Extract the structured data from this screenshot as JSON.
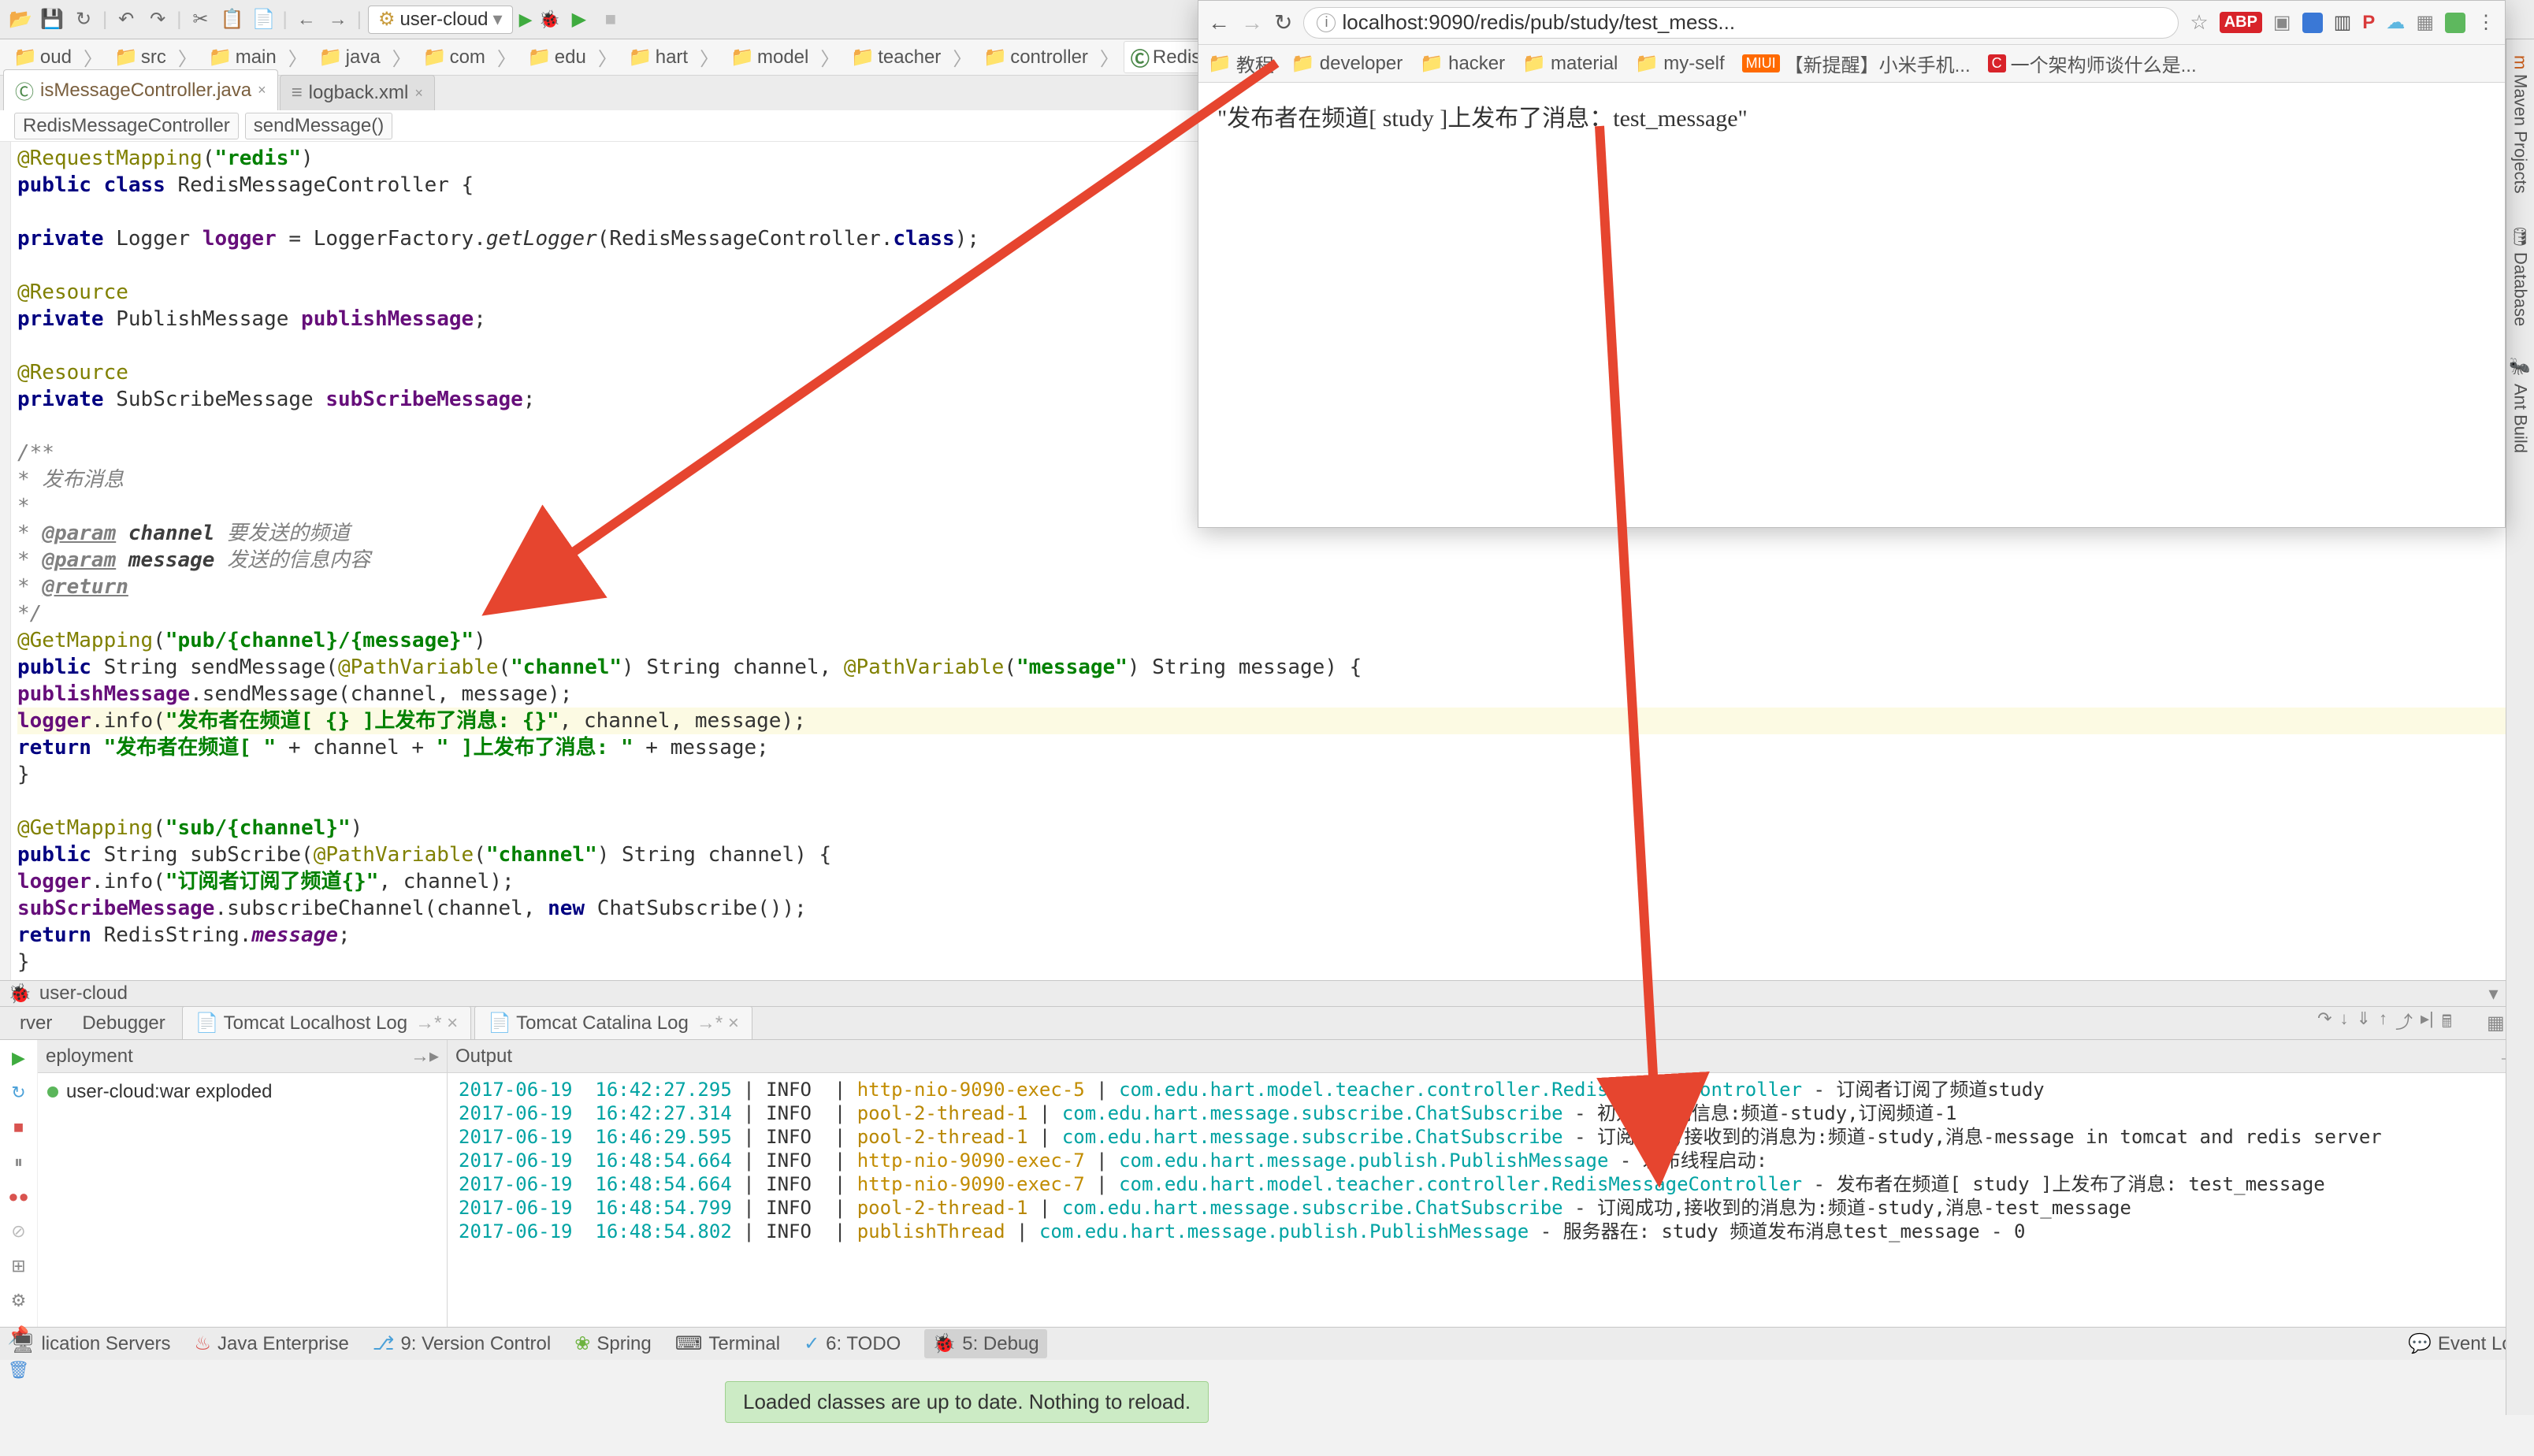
{
  "toolbar": {
    "run_config": "user-cloud"
  },
  "breadcrumbs": [
    "oud",
    "src",
    "main",
    "java",
    "com",
    "edu",
    "hart",
    "model",
    "teacher",
    "controller",
    "RedisMessageController"
  ],
  "tabs": [
    {
      "name": "isMessageController.java",
      "active": true
    },
    {
      "name": "logback.xml",
      "active": false
    }
  ],
  "crumb_inner": [
    "RedisMessageController",
    "sendMessage()"
  ],
  "code": {
    "l1a": "@RequestMapping",
    "l1b": "(",
    "l1c": "\"redis\"",
    "l1d": ")",
    "l2a": "public class ",
    "l2b": "RedisMessageController {",
    "l3a": "    private ",
    "l3b": "Logger ",
    "l3c": "logger",
    "l3d": " = LoggerFactory.",
    "l3e": "getLogger",
    "l3f": "(RedisMessageController.",
    "l3g": "class",
    "l3h": ");",
    "l4": "    @Resource",
    "l5a": "    private ",
    "l5b": "PublishMessage ",
    "l5c": "publishMessage",
    "l5d": ";",
    "l6": "    @Resource",
    "l7a": "    private ",
    "l7b": "SubScribeMessage ",
    "l7c": "subScribeMessage",
    "l7d": ";",
    "l8": "    /**",
    "l9": "     * 发布消息",
    "l10": "     *",
    "l11a": "     * ",
    "l11b": "@param",
    "l11c": " channel",
    "l11d": " 要发送的频道",
    "l12a": "     * ",
    "l12b": "@param",
    "l12c": " message",
    "l12d": " 发送的信息内容",
    "l13a": "     * ",
    "l13b": "@return",
    "l14": "     */",
    "l15a": "    @GetMapping",
    "l15b": "(",
    "l15c": "\"pub/{channel}/{message}\"",
    "l15d": ")",
    "l16a": "    public ",
    "l16b": "String sendMessage(",
    "l16c": "@PathVariable",
    "l16d": "(",
    "l16e": "\"channel\"",
    "l16f": ") String channel, ",
    "l16g": "@PathVariable",
    "l16h": "(",
    "l16i": "\"message\"",
    "l16j": ") String message) {",
    "l17a": "        publishMessage",
    "l17b": ".sendMessage(channel, message);",
    "l18a": "        logger",
    "l18b": ".info(",
    "l18c": "\"发布者在频道[ {} ]上发布了消息: {}\"",
    "l18d": ", channel, message);",
    "l19a": "        return ",
    "l19b": "\"发布者在频道[ \"",
    "l19c": " + channel + ",
    "l19d": "\" ]上发布了消息: \"",
    "l19e": " + message;",
    "l20": "    }",
    "l21a": "    @GetMapping",
    "l21b": "(",
    "l21c": "\"sub/{channel}\"",
    "l21d": ")",
    "l22a": "    public ",
    "l22b": "String subScribe(",
    "l22c": "@PathVariable",
    "l22d": "(",
    "l22e": "\"channel\"",
    "l22f": ") String channel) {",
    "l23a": "        logger",
    "l23b": ".info(",
    "l23c": "\"订阅者订阅了频道{}\"",
    "l23d": ", channel);",
    "l24a": "        subScribeMessage",
    "l24b": ".subscribeChannel(channel, ",
    "l24c": "new ",
    "l24d": "ChatSubscribe());",
    "l25a": "        return ",
    "l25b": "RedisString.",
    "l25c": "message",
    "l25d": ";",
    "l26": "    }"
  },
  "right_tabs": [
    "Maven Projects",
    "Database",
    "Ant Build"
  ],
  "debug": {
    "title": "user-cloud",
    "tabs": [
      "rver",
      "Debugger",
      "Tomcat Localhost Log",
      "Tomcat Catalina Log"
    ],
    "dep_hdr": "eployment",
    "out_hdr": "Output",
    "deployment": "user-cloud:war exploded"
  },
  "console_lines": [
    {
      "d": "2017-06-19",
      "t": "16:42:27.295",
      "lvl": "INFO",
      "th": "http-nio-9090-exec-5",
      "thc": "th-http",
      "cls": "com.edu.hart.model.teacher.controller.RedisMessageController",
      "msg": "- 订阅者订阅了频道study"
    },
    {
      "d": "2017-06-19",
      "t": "16:42:27.314",
      "lvl": "INFO",
      "th": "pool-2-thread-1",
      "thc": "th-pool",
      "cls": "com.edu.hart.message.subscribe.ChatSubscribe",
      "msg": "- 初始化订阅信息:频道-study,订阅频道-1"
    },
    {
      "d": "2017-06-19",
      "t": "16:46:29.595",
      "lvl": "INFO",
      "th": "pool-2-thread-1",
      "thc": "th-pool",
      "cls": "com.edu.hart.message.subscribe.ChatSubscribe",
      "msg": "- 订阅成功,接收到的消息为:频道-study,消息-message in tomcat and redis server"
    },
    {
      "d": "2017-06-19",
      "t": "16:48:54.664",
      "lvl": "INFO",
      "th": "http-nio-9090-exec-7",
      "thc": "th-http",
      "cls": "com.edu.hart.message.publish.PublishMessage",
      "msg": "- 发布线程启动:"
    },
    {
      "d": "2017-06-19",
      "t": "16:48:54.664",
      "lvl": "INFO",
      "th": "http-nio-9090-exec-7",
      "thc": "th-http",
      "cls": "com.edu.hart.model.teacher.controller.RedisMessageController",
      "msg": "- 发布者在频道[ study ]上发布了消息: test_message"
    },
    {
      "d": "2017-06-19",
      "t": "16:48:54.799",
      "lvl": "INFO",
      "th": "pool-2-thread-1",
      "thc": "th-pool",
      "cls": "com.edu.hart.message.subscribe.ChatSubscribe",
      "msg": "- 订阅成功,接收到的消息为:频道-study,消息-test_message"
    },
    {
      "d": "2017-06-19",
      "t": "16:48:54.802",
      "lvl": "INFO",
      "th": "publishThread",
      "thc": "th-pub",
      "cls": "com.edu.hart.message.publish.PublishMessage",
      "msg": "- 服务器在: study 频道发布消息test_message - 0"
    }
  ],
  "bottom": {
    "items": [
      "lication Servers",
      "Java Enterprise",
      "9: Version Control",
      "Spring",
      "Terminal",
      "6: TODO",
      "5: Debug"
    ],
    "event_log": "Event Log"
  },
  "reload": "Loaded classes are up to date. Nothing to reload.",
  "browser": {
    "url": "localhost:9090/redis/pub/study/test_mess...",
    "bookmarks": [
      "教程",
      "developer",
      "hacker",
      "material",
      "my-self",
      "【新提醒】小米手机...",
      "一个架构师谈什么是..."
    ],
    "content": "\"发布者在频道[ study ]上发布了消息：test_message\""
  }
}
